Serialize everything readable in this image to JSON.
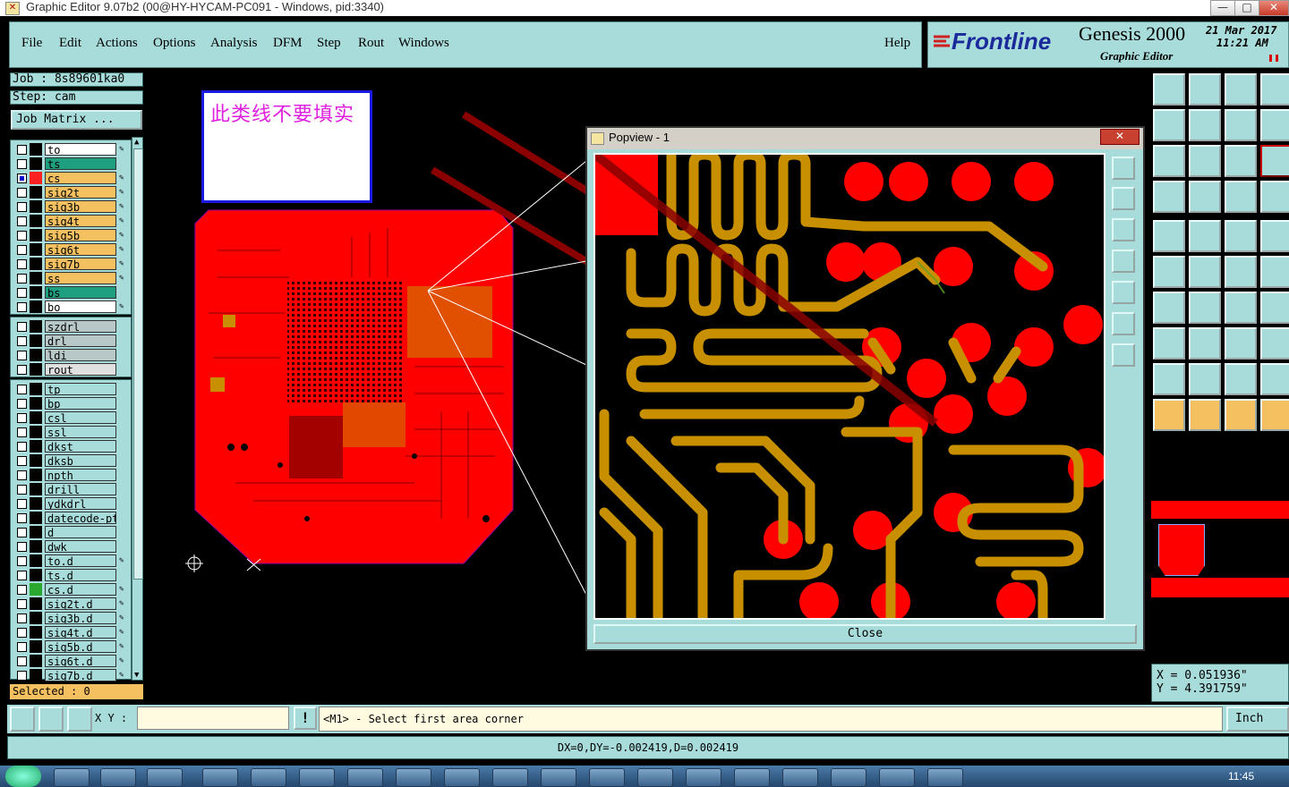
{
  "window": {
    "title": "Graphic Editor 9.07b2 (00@HY-HYCAM-PC091 - Windows, pid:3340)",
    "btn_min": "—",
    "btn_max": "□",
    "btn_close": "✕"
  },
  "menu": {
    "items": [
      "File",
      "Edit",
      "Actions",
      "Options",
      "Analysis",
      "DFM",
      "Step",
      "Rout",
      "Windows"
    ],
    "help": "Help"
  },
  "brand": {
    "logo": "Frontline",
    "product": "Genesis 2000",
    "subtitle": "Graphic Editor",
    "date": "21 Mar 2017",
    "time": "11:21 AM"
  },
  "job": {
    "job_line": "Job : 8s89601ka0",
    "step_line": "Step: cam",
    "matrix_button": "Job Matrix ..."
  },
  "layers_group1": [
    {
      "name": "to",
      "color": "#ffffff",
      "swatch": "#000000",
      "edit": "✎"
    },
    {
      "name": "ts",
      "color": "#1ea080",
      "swatch": "#000000",
      "edit": ""
    },
    {
      "name": "cs",
      "color": "#f4c060",
      "swatch": "#ff2020",
      "edit": "✎",
      "checked": true
    },
    {
      "name": "sig2t",
      "color": "#f4c060",
      "swatch": "#000000",
      "edit": "✎"
    },
    {
      "name": "sig3b",
      "color": "#f4c060",
      "swatch": "#000000",
      "edit": "✎"
    },
    {
      "name": "sig4t",
      "color": "#f4c060",
      "swatch": "#000000",
      "edit": "✎"
    },
    {
      "name": "sig5b",
      "color": "#f4c060",
      "swatch": "#000000",
      "edit": "✎"
    },
    {
      "name": "sig6t",
      "color": "#f4c060",
      "swatch": "#000000",
      "edit": "✎"
    },
    {
      "name": "sig7b",
      "color": "#f4c060",
      "swatch": "#000000",
      "edit": "✎"
    },
    {
      "name": "ss",
      "color": "#f4c060",
      "swatch": "#000000",
      "edit": "✎"
    },
    {
      "name": "bs",
      "color": "#1ea080",
      "swatch": "#000000",
      "edit": ""
    },
    {
      "name": "bo",
      "color": "#ffffff",
      "swatch": "#000000",
      "edit": "✎"
    }
  ],
  "layers_group2": [
    {
      "name": "szdrl",
      "color": "#b8c8c8",
      "swatch": "#000000"
    },
    {
      "name": "drl",
      "color": "#b8c8c8",
      "swatch": "#000000"
    },
    {
      "name": "ldi",
      "color": "#b8c8c8",
      "swatch": "#000000"
    },
    {
      "name": "rout",
      "color": "#e0e0e0",
      "swatch": "#000000"
    }
  ],
  "layers_group3": [
    {
      "name": "tp",
      "edit": ""
    },
    {
      "name": "bp",
      "edit": ""
    },
    {
      "name": "csl",
      "edit": ""
    },
    {
      "name": "ssl",
      "edit": ""
    },
    {
      "name": "dkst",
      "edit": ""
    },
    {
      "name": "dksb",
      "edit": ""
    },
    {
      "name": "npth",
      "edit": ""
    },
    {
      "name": "drill",
      "edit": ""
    },
    {
      "name": "ydkdrl",
      "edit": ""
    },
    {
      "name": "datecode-ptc",
      "edit": ""
    },
    {
      "name": "d",
      "edit": ""
    },
    {
      "name": "dwk",
      "edit": ""
    },
    {
      "name": "to.d",
      "edit": "✎"
    },
    {
      "name": "ts.d",
      "edit": ""
    },
    {
      "name": "cs.d",
      "edit": "✎",
      "green": true
    },
    {
      "name": "sig2t.d",
      "edit": "✎"
    },
    {
      "name": "sig3b.d",
      "edit": "✎"
    },
    {
      "name": "sig4t.d",
      "edit": "✎"
    },
    {
      "name": "sig5b.d",
      "edit": "✎"
    },
    {
      "name": "sig6t.d",
      "edit": "✎"
    },
    {
      "name": "sig7b.d",
      "edit": "✎"
    }
  ],
  "selected": "Selected : 0",
  "note": "此类线不要填实",
  "popview": {
    "title": "Popview - 1",
    "close_x": "✕",
    "close_button": "Close"
  },
  "coords": {
    "x": "X = 0.051936\"",
    "y": "Y = 4.391759\""
  },
  "cmd": {
    "xy_label": "X Y :",
    "xy_value": "",
    "prompt": "<M1> - Select first area corner",
    "units": "Inch"
  },
  "status": "DX=0,DY=-0.002419,D=0.002419",
  "taskbar": {
    "clock": "11:45"
  },
  "colors": {
    "panel": "#a8dcda",
    "copper": "#ff0000",
    "trace": "#c89000",
    "accent_orange": "#f4c060"
  }
}
